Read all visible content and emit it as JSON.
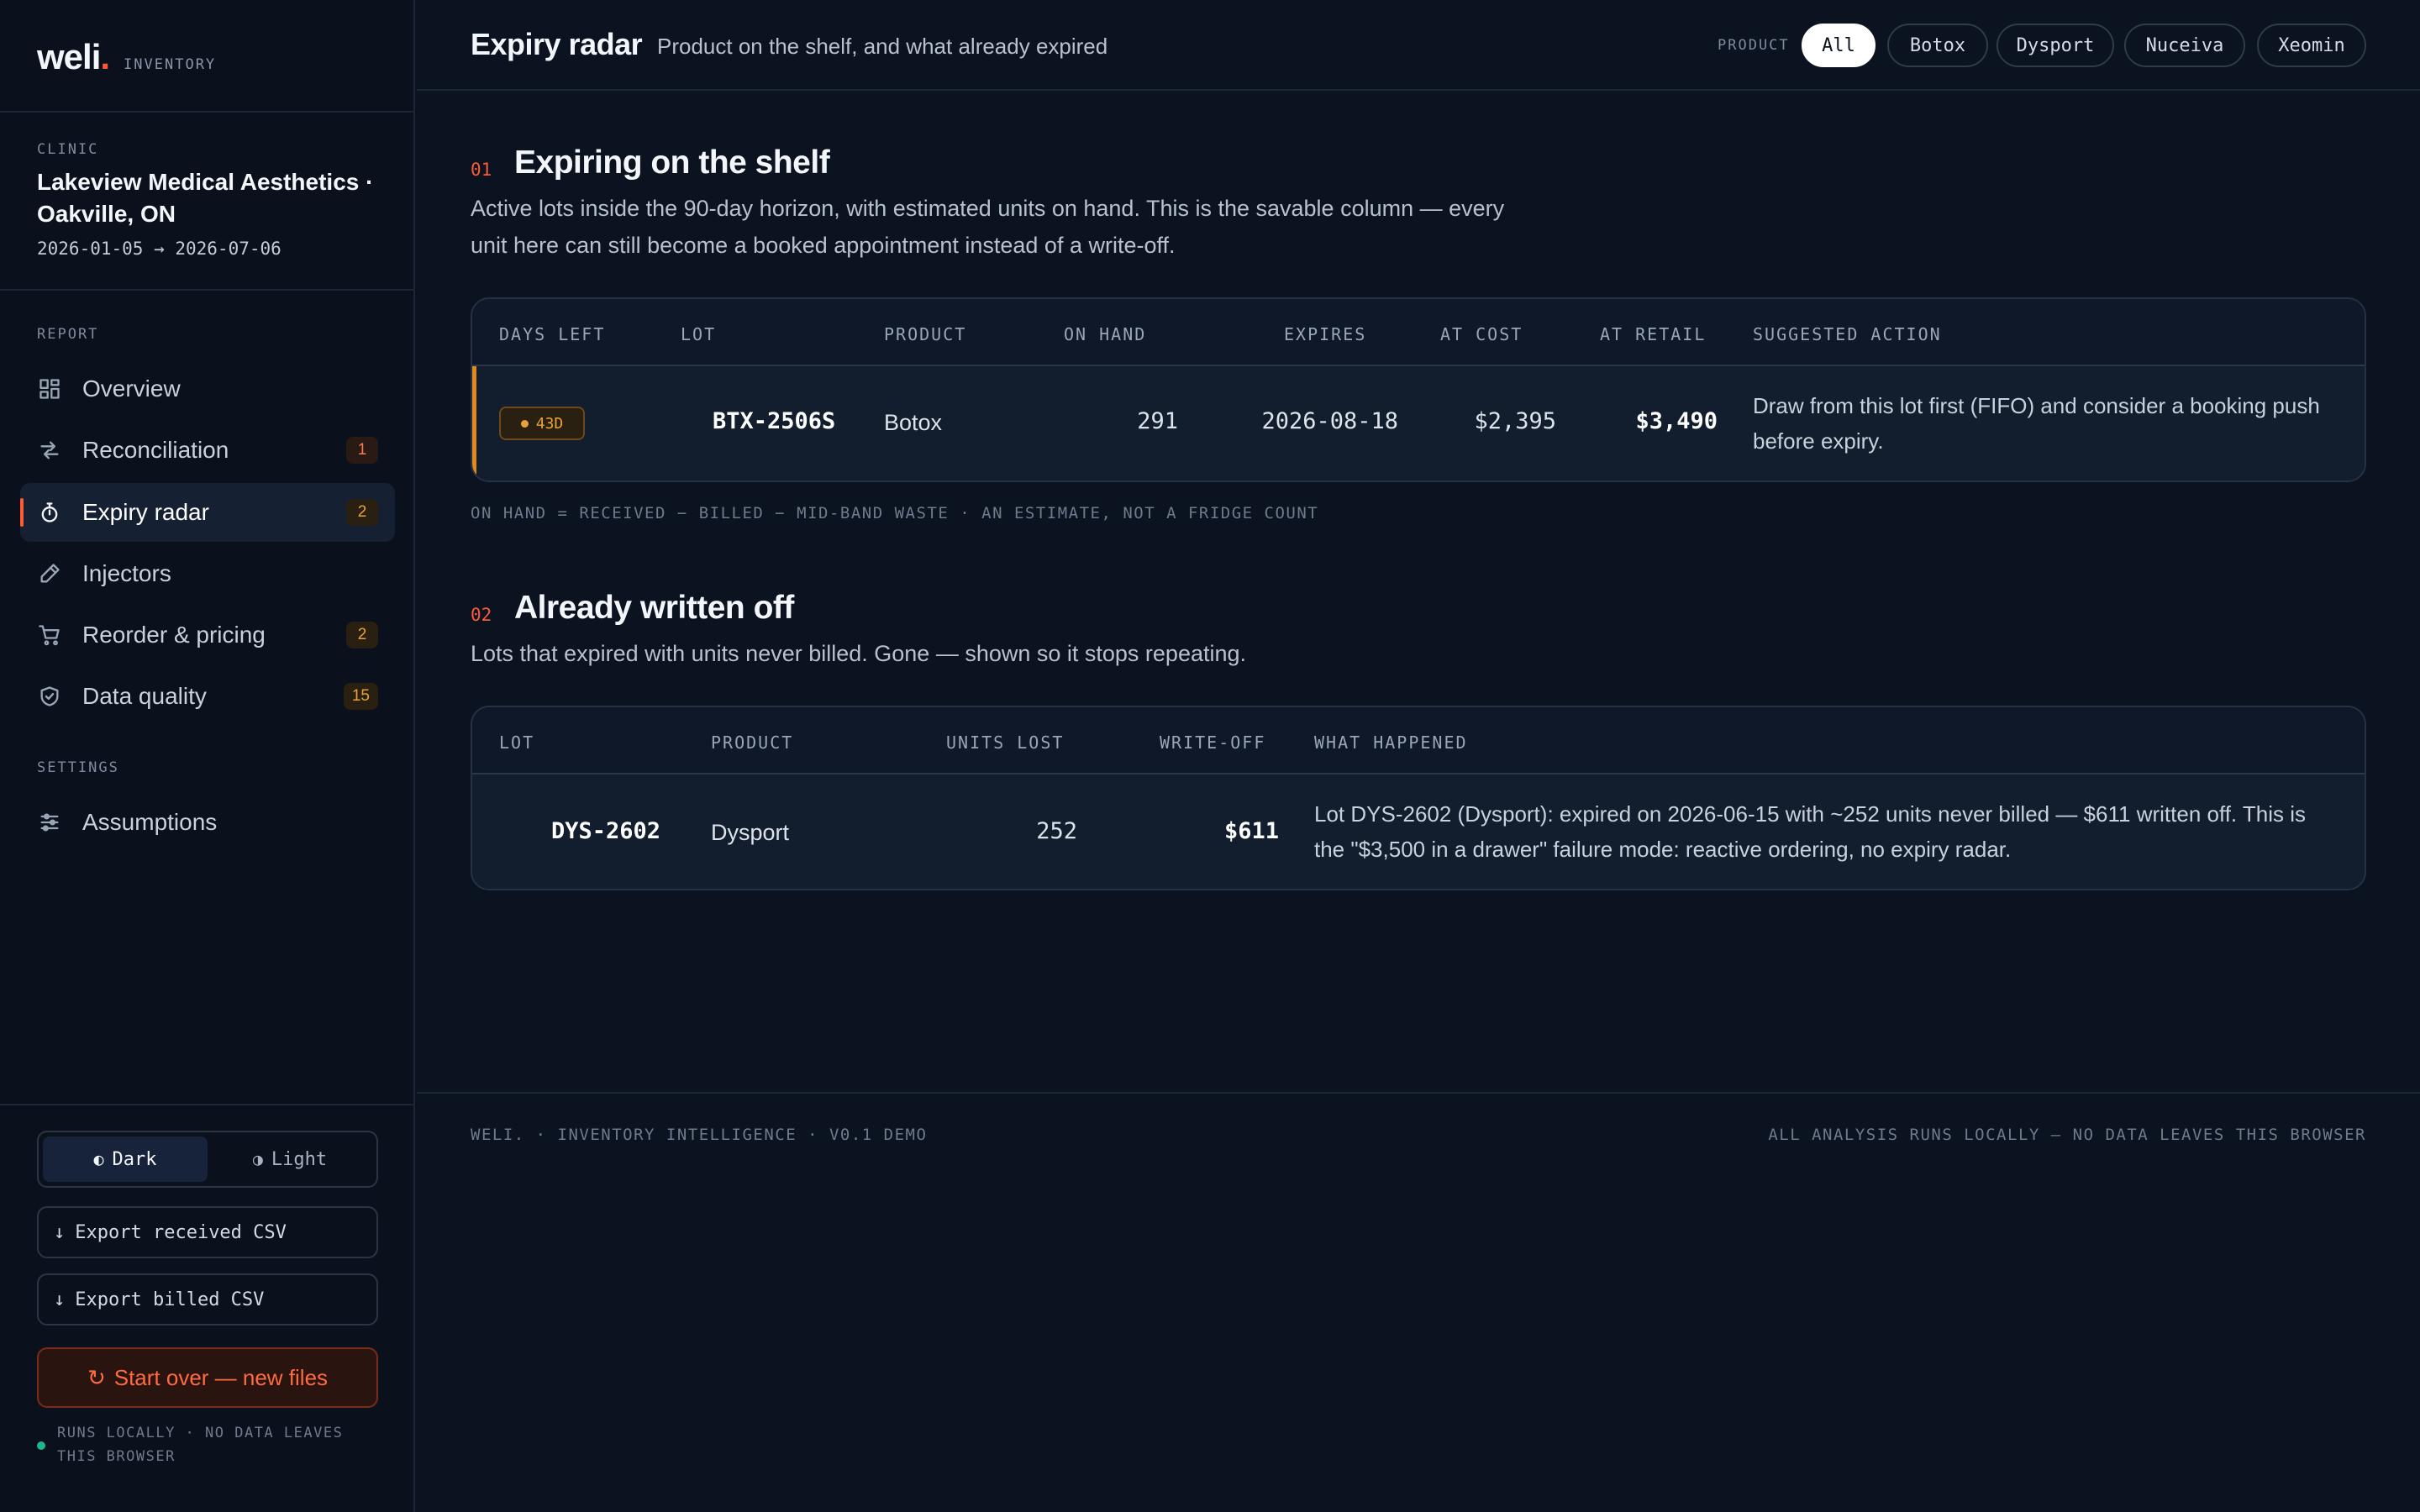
{
  "brand": {
    "word": "weli",
    "dot": ".",
    "sub": "INVENTORY"
  },
  "clinic": {
    "label": "CLINIC",
    "name": "Lakeview Medical Aesthetics · Oakville, ON",
    "dates": "2026-01-05 → 2026-07-06"
  },
  "sidebar": {
    "report_label": "REPORT",
    "settings_label": "SETTINGS",
    "items": [
      {
        "label": "Overview",
        "icon": "grid-icon",
        "badge": ""
      },
      {
        "label": "Reconciliation",
        "icon": "arrows-swap-icon",
        "badge": "1"
      },
      {
        "label": "Expiry radar",
        "icon": "stopwatch-icon",
        "badge": "2"
      },
      {
        "label": "Injectors",
        "icon": "pen-icon",
        "badge": ""
      },
      {
        "label": "Reorder & pricing",
        "icon": "cart-icon",
        "badge": "2"
      },
      {
        "label": "Data quality",
        "icon": "shield-check-icon",
        "badge": "15"
      }
    ],
    "settings_items": [
      {
        "label": "Assumptions",
        "icon": "sliders-icon"
      }
    ],
    "theme": {
      "dark": "Dark",
      "light": "Light",
      "selected": "Dark"
    },
    "export_received": "Export received CSV",
    "export_billed": "Export billed CSV",
    "start_over": "Start over — new files",
    "local_note": "RUNS LOCALLY · NO DATA LEAVES THIS BROWSER"
  },
  "header": {
    "title": "Expiry radar",
    "subtitle": "Product on the shelf, and what already expired",
    "filter_label": "PRODUCT",
    "filters": [
      "All",
      "Botox",
      "Dysport",
      "Nuceiva",
      "Xeomin"
    ],
    "selected_filter": "All"
  },
  "shelf": {
    "num": "01",
    "title": "Expiring on the shelf",
    "desc": "Active lots inside the 90-day horizon, with estimated units on hand. This is the savable column — every unit here can still become a booked appointment instead of a write-off.",
    "columns": [
      "DAYS LEFT",
      "LOT",
      "PRODUCT",
      "ON HAND",
      "EXPIRES",
      "AT COST",
      "AT RETAIL",
      "SUGGESTED ACTION"
    ],
    "rows": [
      {
        "days_left": "43D",
        "lot": "BTX-2506S",
        "product": "Botox",
        "on_hand": "291",
        "expires": "2026-08-18",
        "at_cost": "$2,395",
        "at_retail": "$3,490",
        "action": "Draw from this lot first (FIFO) and consider a booking push before expiry."
      }
    ],
    "footnote": "ON HAND = RECEIVED − BILLED − MID-BAND WASTE · AN ESTIMATE, NOT A FRIDGE COUNT"
  },
  "written_off": {
    "num": "02",
    "title": "Already written off",
    "desc": "Lots that expired with units never billed. Gone — shown so it stops repeating.",
    "columns": [
      "LOT",
      "PRODUCT",
      "UNITS LOST",
      "WRITE-OFF",
      "WHAT HAPPENED"
    ],
    "rows": [
      {
        "lot": "DYS-2602",
        "product": "Dysport",
        "units_lost": "252",
        "write_off": "$611",
        "what_happened": "Lot DYS-2602 (Dysport): expired on 2026-06-15 with ~252 units never billed — $611 written off. This is the \"$3,500 in a drawer\" failure mode: reactive ordering, no expiry radar."
      }
    ]
  },
  "footer": {
    "left": "WELI. · INVENTORY INTELLIGENCE · V0.1 DEMO",
    "right": "ALL ANALYSIS RUNS LOCALLY — NO DATA LEAVES THIS BROWSER"
  },
  "colors": {
    "accent": "#ff5a36",
    "warning": "#e8a23a",
    "background": "#0b1220",
    "sidebar": "#0a111d",
    "ok": "#1fb58a"
  }
}
